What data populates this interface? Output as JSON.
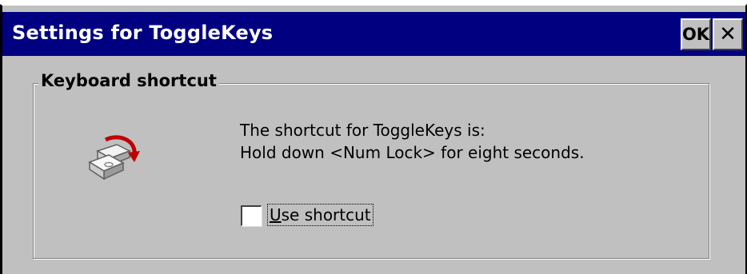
{
  "window": {
    "title": "Settings for ToggleKeys",
    "ok_label": "OK",
    "close_glyph": "✕",
    "title_bar_color": "#000080",
    "face_color": "#c0c0c0"
  },
  "group": {
    "label": "Keyboard shortcut",
    "icon": "togglekeys-icon",
    "description_line1": "The shortcut for ToggleKeys is:",
    "description_line2": "Hold down <Num Lock> for eight seconds.",
    "checkbox": {
      "label_underlined": "U",
      "label_rest": "se shortcut",
      "checked": false
    }
  }
}
